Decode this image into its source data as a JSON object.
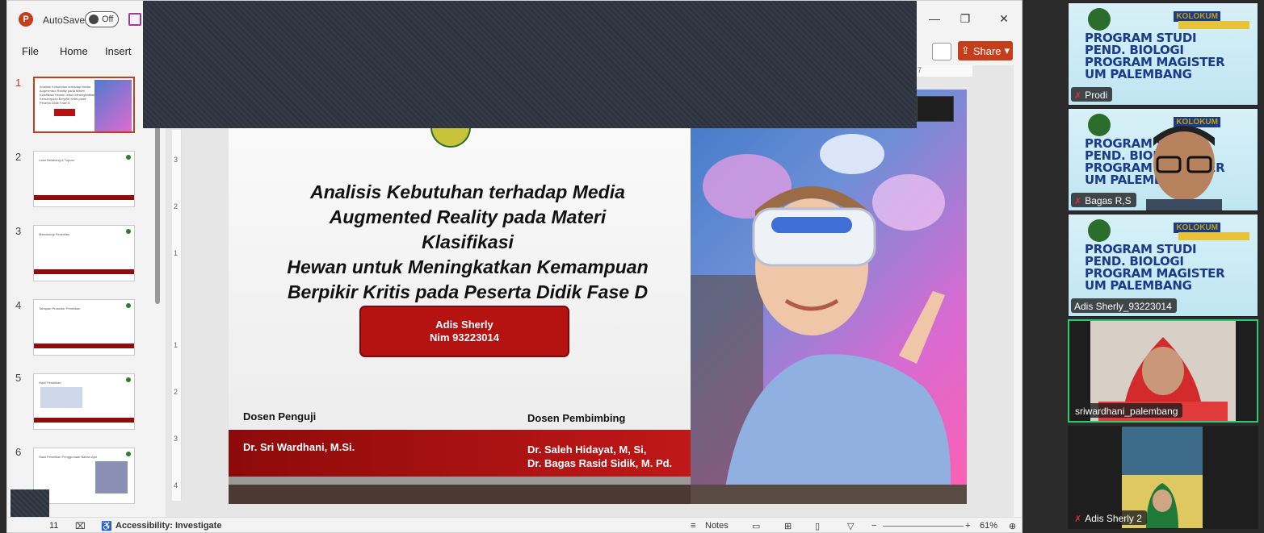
{
  "app": {
    "autosave_label": "AutoSave",
    "toggle_state": "Off",
    "menu": [
      "File",
      "Home",
      "Insert"
    ],
    "share_label": "Share",
    "logo_letter": "P"
  },
  "thumbnails": [
    {
      "num": "1",
      "title": "Analisis Kebutuhan terhadap Media Augmented Reality pada Materi Klasifikasi Hewan untuk Meningkatkan Kemampuan Berpikir Kritis pada Peserta Didik Fase D"
    },
    {
      "num": "2",
      "title": "Latar Belakang & Tujuan"
    },
    {
      "num": "3",
      "title": "Metodologi Penelitian"
    },
    {
      "num": "4",
      "title": "Tahapan Prosedur Penelitian"
    },
    {
      "num": "5",
      "title": "Hasil Penelitian"
    },
    {
      "num": "6",
      "title": "Hasil Penelitian Penggunaan Bahan Ajar"
    }
  ],
  "slide": {
    "title_lines": [
      "Analisis Kebutuhan terhadap Media",
      "Augmented Reality pada Materi Klasifikasi",
      "Hewan untuk Meningkatkan Kemampuan",
      "Berpikir Kritis pada Peserta Didik Fase D"
    ],
    "student_name": "Adis Sherly",
    "student_nim": "Nim 93223014",
    "penguji_label": "Dosen Penguji",
    "penguji_name": "Dr. Sri Wardhani, M.Si.",
    "pembimbing_label": "Dosen Pembimbing",
    "pembimbing_names": [
      "Dr. Saleh Hidayat, M, Si,",
      "Dr. Bagas Rasid Sidik, M. Pd."
    ]
  },
  "rulers": {
    "vertical": [
      "3",
      "2",
      "1",
      "1",
      "2",
      "3",
      "4"
    ],
    "horizontal": "7"
  },
  "status": {
    "slide_count": "11",
    "accessibility": "Accessibility: Investigate",
    "notes": "Notes",
    "zoom": "61%"
  },
  "participants": [
    {
      "name": "Prodi",
      "muted": true
    },
    {
      "name": "Bagas R,S",
      "muted": true
    },
    {
      "name": "Adis Sherly_93223014",
      "muted": false
    },
    {
      "name": "sriwardhani_palembang",
      "muted": false
    },
    {
      "name": "Adis Sherly 2",
      "muted": true
    }
  ],
  "poster": {
    "lines": [
      "PROGRAM STUDI",
      "PEND. BIOLOGI",
      "PROGRAM MAGISTER",
      "UM PALEMBANG"
    ],
    "badge": "KOLOKUM"
  }
}
